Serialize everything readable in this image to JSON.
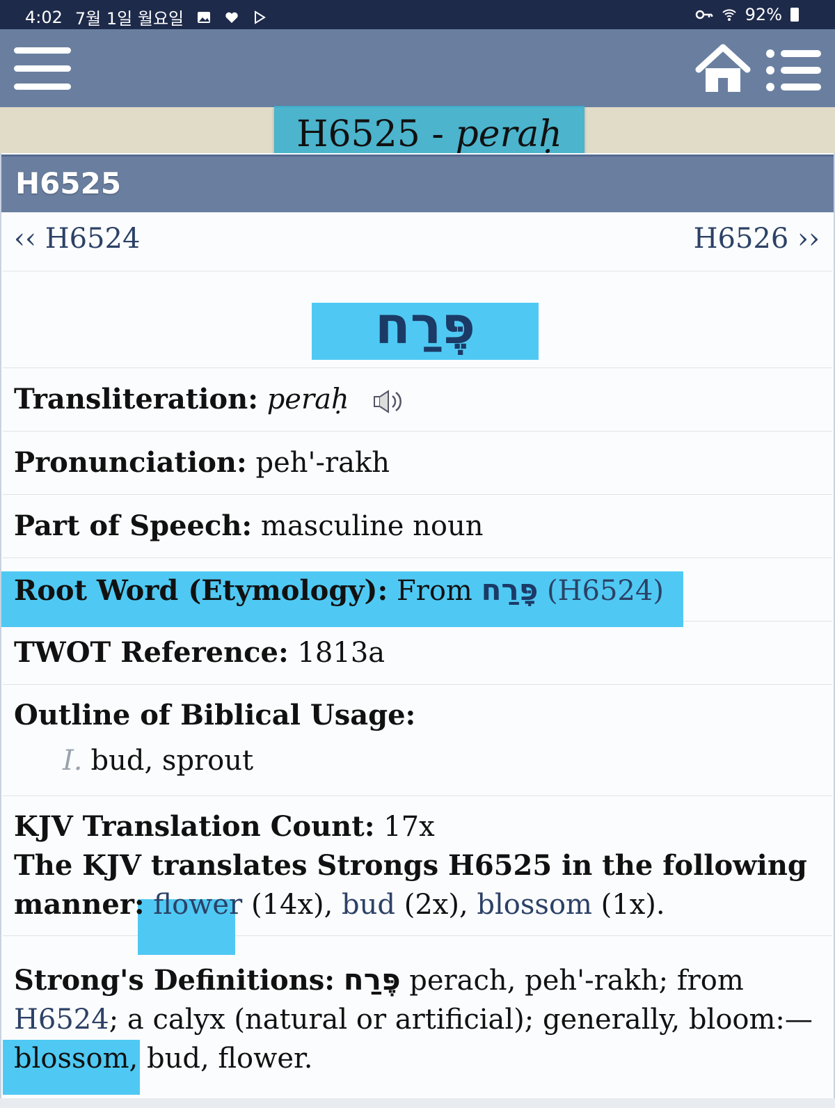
{
  "status": {
    "time": "4:02",
    "date": "7월 1일 월요일",
    "battery": "92%"
  },
  "appbar": {
    "menu_icon": "hamburger-menu-icon",
    "home_icon": "home-icon",
    "list_icon": "list-icon"
  },
  "title": {
    "code": "H6525 - ",
    "word": "peraḥ"
  },
  "header": {
    "code": "H6525"
  },
  "nav": {
    "prev": "‹‹ H6524",
    "next": "H6526 ››"
  },
  "hebrew": "פֶּרַח",
  "transliteration": {
    "label": "Transliteration:",
    "value": "peraḥ",
    "icon": "speaker-icon"
  },
  "pronunciation": {
    "label": "Pronunciation:",
    "value": "peh'-rakh"
  },
  "part_of_speech": {
    "label": "Part of Speech:",
    "value": "masculine noun"
  },
  "root_word": {
    "label": "Root Word (Etymology):",
    "from": "From",
    "hebrew": "פָּרַח",
    "ref": "(H6524)"
  },
  "twot": {
    "label": "TWOT Reference:",
    "value": "1813a"
  },
  "outline": {
    "label": "Outline of Biblical Usage:",
    "items": [
      {
        "num": "I.",
        "text": "bud, sprout"
      }
    ]
  },
  "kjv": {
    "count_label": "KJV Translation Count:",
    "count": "17x",
    "manner_label": "The KJV translates Strongs H6525 in the following manner:",
    "translations": [
      {
        "word": "flower",
        "count": "(14x),"
      },
      {
        "word": "bud",
        "count": "(2x),"
      },
      {
        "word": "blossom",
        "count": "(1x)."
      }
    ]
  },
  "strongs": {
    "label": "Strong's Definitions:",
    "hebrew": "פֶּרַח",
    "text1": "perach, peh'-rakh; from",
    "link": "H6524",
    "text2": "; a calyx (natural or artificial); generally, bloom:—blossom, bud, flower."
  }
}
